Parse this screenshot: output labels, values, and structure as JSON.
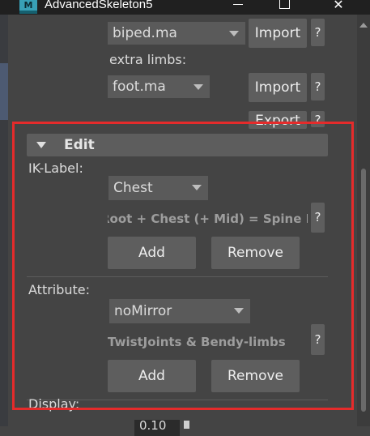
{
  "window": {
    "title": "AdvancedSkeleton5",
    "app_icon_letter": "M",
    "minimize_label": "—",
    "maximize_label": "☐",
    "close_label": "✕"
  },
  "top_section": {
    "biped_dropdown_value": "biped.ma",
    "import_label": "Import",
    "help_label": "?",
    "extra_limbs_label": "extra limbs:",
    "foot_dropdown_value": "foot.ma",
    "import2_label": "Import",
    "help2_label": "?",
    "export_label": "Export",
    "help3_label": "?"
  },
  "edit_section": {
    "header": "Edit",
    "ik_label": "IK-Label:",
    "ik_dropdown_value": "Chest",
    "ik_info_text": "Root + Chest (+ Mid) = Spine IK",
    "ik_help": "?",
    "ik_add": "Add",
    "ik_remove": "Remove",
    "attribute_label": "Attribute:",
    "attr_dropdown_value": "noMirror",
    "attr_info_text": "TwistJoints & Bendy-limbs",
    "attr_help": "?",
    "attr_add": "Add",
    "attr_remove": "Remove",
    "display_label": "Display:",
    "bottom_value": "0.10"
  },
  "colors": {
    "highlight_frame": "#e52b2b",
    "background": "#444444",
    "titlebar": "#202020"
  }
}
